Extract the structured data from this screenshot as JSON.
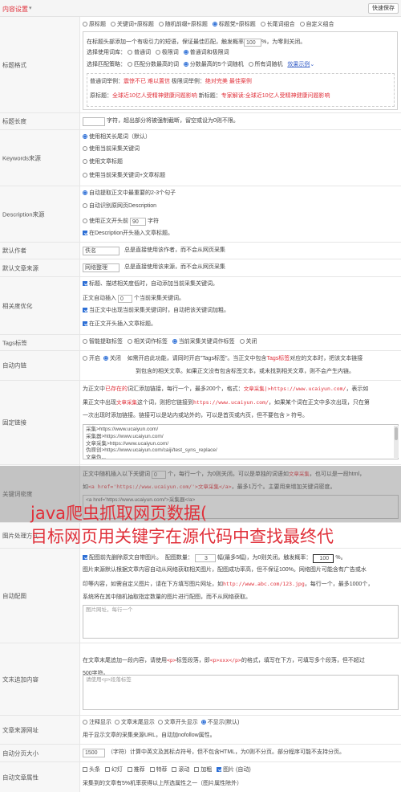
{
  "header": {
    "section_title": "内容设置",
    "caret": "▾",
    "quick_save": "快速保存"
  },
  "title_format": {
    "label": "标题格式",
    "modes": [
      "原标题",
      "关键词+原标题",
      "随机前缀+原标题",
      "标题党+原标题",
      "长尾词组合",
      "自定义组合"
    ],
    "description": "在标题头部添加一个有吸引力的短语，保证最佳匹配，触发概率",
    "probability": "100",
    "probability_suffix": "%，为零则关闭。",
    "lexicon_label": "选择使用词库：",
    "lexicon_options": [
      "普通词",
      "极限词",
      "普通词和极限词"
    ],
    "match_label": "选择匹配策略：",
    "match_options": [
      "匹配分数最高的词",
      "分数最高的5个词随机",
      "所有词随机"
    ],
    "effect_link": "效果示例",
    "example_line1_prefix": "普通词举例：",
    "example_line1_red": "震惊不已 难以置信",
    "example_line1_mid": " 极限词举例：",
    "example_line1_red2": "绝对完美 最佳案例",
    "example_line2_prefix": "原标题：",
    "example_line2_red": "全球近10亿人受精神健康问题影响",
    "example_line2_mid": " 新标题：",
    "example_line2_red2": "专家解读:全球近10亿人受精神健康问题影响"
  },
  "title_length": {
    "label": "标题长度",
    "suffix": "字符，超出部分将被强制截断，留空或设为0则不限。"
  },
  "keywords_source": {
    "label": "Keywords来源",
    "options": [
      "使用相关长尾词（默认）",
      "使用当前采集关键词",
      "使用文章标题",
      "使用当前采集关键词+文章标题"
    ]
  },
  "description_source": {
    "label": "Description来源",
    "options": [
      "自动提取正文中最重要的2-3个句子",
      "自动识别原网页Description",
      "使用正文开头前",
      "字符"
    ],
    "chars": "90",
    "checkbox": "在Description开头插入文章标题。"
  },
  "default_author": {
    "label": "默认作者",
    "value": "佚名",
    "hint": "总是直接使用该作者，而不会从网页采集"
  },
  "default_source": {
    "label": "默认文章来源",
    "value": "网络整理",
    "hint": "总是直接使用该来源，而不会从网页采集"
  },
  "seo": {
    "label": "相关度优化",
    "line1": "标题、描述相关度低时，自动添加当前采集关键词。",
    "line2_prefix": "正文自动插入",
    "line2_value": "0",
    "line2_suffix": "个当前采集关键词。",
    "line3": "当正文中出现当前采集关键词时，自动把该关键词加粗。",
    "line4": "在正文开头插入文章标题。"
  },
  "tags": {
    "label": "Tags标签",
    "options": [
      "智能提取标签",
      "相关词作标签",
      "当前采集关键词作标签",
      "关闭"
    ]
  },
  "auto_link": {
    "label": "自动内链",
    "options": [
      "开启",
      "关闭"
    ],
    "desc1_prefix": "如需开启此功能，请同时开启\"Tags标签\"。当正文中包含",
    "desc1_link": "Tags标签",
    "desc1_suffix": "对应的文本时，把该文本链接",
    "desc2": "到包含的相关文章。如果正文没有包含标签文本，或未找到相关文章，则不会产生内链。"
  },
  "fixed_link": {
    "label": "固定链接",
    "l1_a": "为正文中",
    "l1_red": "已存在的",
    "l1_b": "词汇添加链接，每行一个，最多200个，格式：",
    "l1_code": "文章采集|>https://www.ucaiyun.com/",
    "l1_c": "，表示如",
    "l2_a": "果正文中出现",
    "l2_code": "文章采集",
    "l2_b": "这个词，则把它链接到",
    "l2_code2": "https://www.ucaiyun.com/",
    "l2_c": "，如果某个词在正文中多次出现，只在第",
    "l3": "一次出现时添加链接。链接可以是站内或站外的，可以是首页或内页，但不要包含 > 符号。",
    "textarea": "采集>https://www.ucaiyun.com/\n采集器>https://www.ucaiyun.com/\n文章采集>https://www.ucaiyun.com/\n伪原创>https://www.ucaiyun.com/caiji/test_syns_replace/\n文章伪..."
  },
  "keyword_density": {
    "label": "关键词密度",
    "l1_a": "正文中随机插入以下关键词",
    "l1_value": "0",
    "l1_b": "个，每行一个，为0则关闭。可以是单独的词语如",
    "l1_code": "文章采集",
    "l1_c": "，也可以是一段html，",
    "l2_a": "如",
    "l2_code": "<a href='https://www.ucaiyun.com/'>文章采集</a>",
    "l2_b": "，最多1万个。主要用来增加关键词密度。",
    "textarea": "<a href='https://www.ucaiyun.com/'>采集器</a>"
  },
  "watermark": {
    "line1": "java爬虫抓取网页数据(",
    "line2": "目标网页用关键字在源代码中查找最终代"
  },
  "image_process": {
    "label": "图片处理方式"
  },
  "auto_image": {
    "label": "自动配图",
    "l1_a": "配图前先删除原文自带图片。",
    "l1_b": "配图数量：",
    "l1_count": "3",
    "l1_c": "幅(最多5幅)，为0则关闭。触发概率：",
    "l1_prob": "100",
    "l1_d": "%。",
    "l2": "图片来源默认根据文章内容自动从网络获取相关图片，配图成功率高，但不保证100%。网络图片可能含有广告或水",
    "l3_a": "印等内容，如需自定义图片，请在下方填写图片网址，如",
    "l3_code": "http://www.abc.com/123.jpg",
    "l3_b": "，每行一个，最多1000个，",
    "l4": "系统将在其中随机抽取指定数量的图片进行配图，而不从网络获取。",
    "placeholder": "图片网址，每行一个"
  },
  "tail_content": {
    "label": "文末追加内容",
    "l1_a": "在文章末尾追加一段内容，请使用",
    "l1_code": "<p>",
    "l1_b": "标签段落，即",
    "l1_code2": "<p>xxx</p>",
    "l1_c": "的格式，填写在下方，可填写多个段落，但不超过",
    "l2": "500字符。",
    "placeholder": "请使用<p>段落标签"
  },
  "source_url": {
    "label": "文章来源网址",
    "options": [
      "注释显示",
      "文章末尾显示",
      "文章开头显示",
      "不显示(默认)"
    ],
    "hint": "用于显示文章的采集来源URL，自动加nofollow属性。"
  },
  "pagination": {
    "label": "自动分页大小",
    "value": "1500",
    "hint": "（字符）计算中英文及其标点符号，但不包含HTML，为0则不分页。部分程序可能不支持分页。"
  },
  "article_attrs": {
    "label": "自动文章属性",
    "options": [
      "头条",
      "幻灯",
      "推荐",
      "特荐",
      "滚动",
      "加粗",
      "图片 (自动)"
    ],
    "hint": "采集到的文章有5%机率获得以上所选属性之一（图片属性除外）"
  },
  "colors": {
    "accent_red": "#e0303a",
    "radio_blue": "#2d6fd6",
    "label_bg": "#f7f7f7"
  }
}
